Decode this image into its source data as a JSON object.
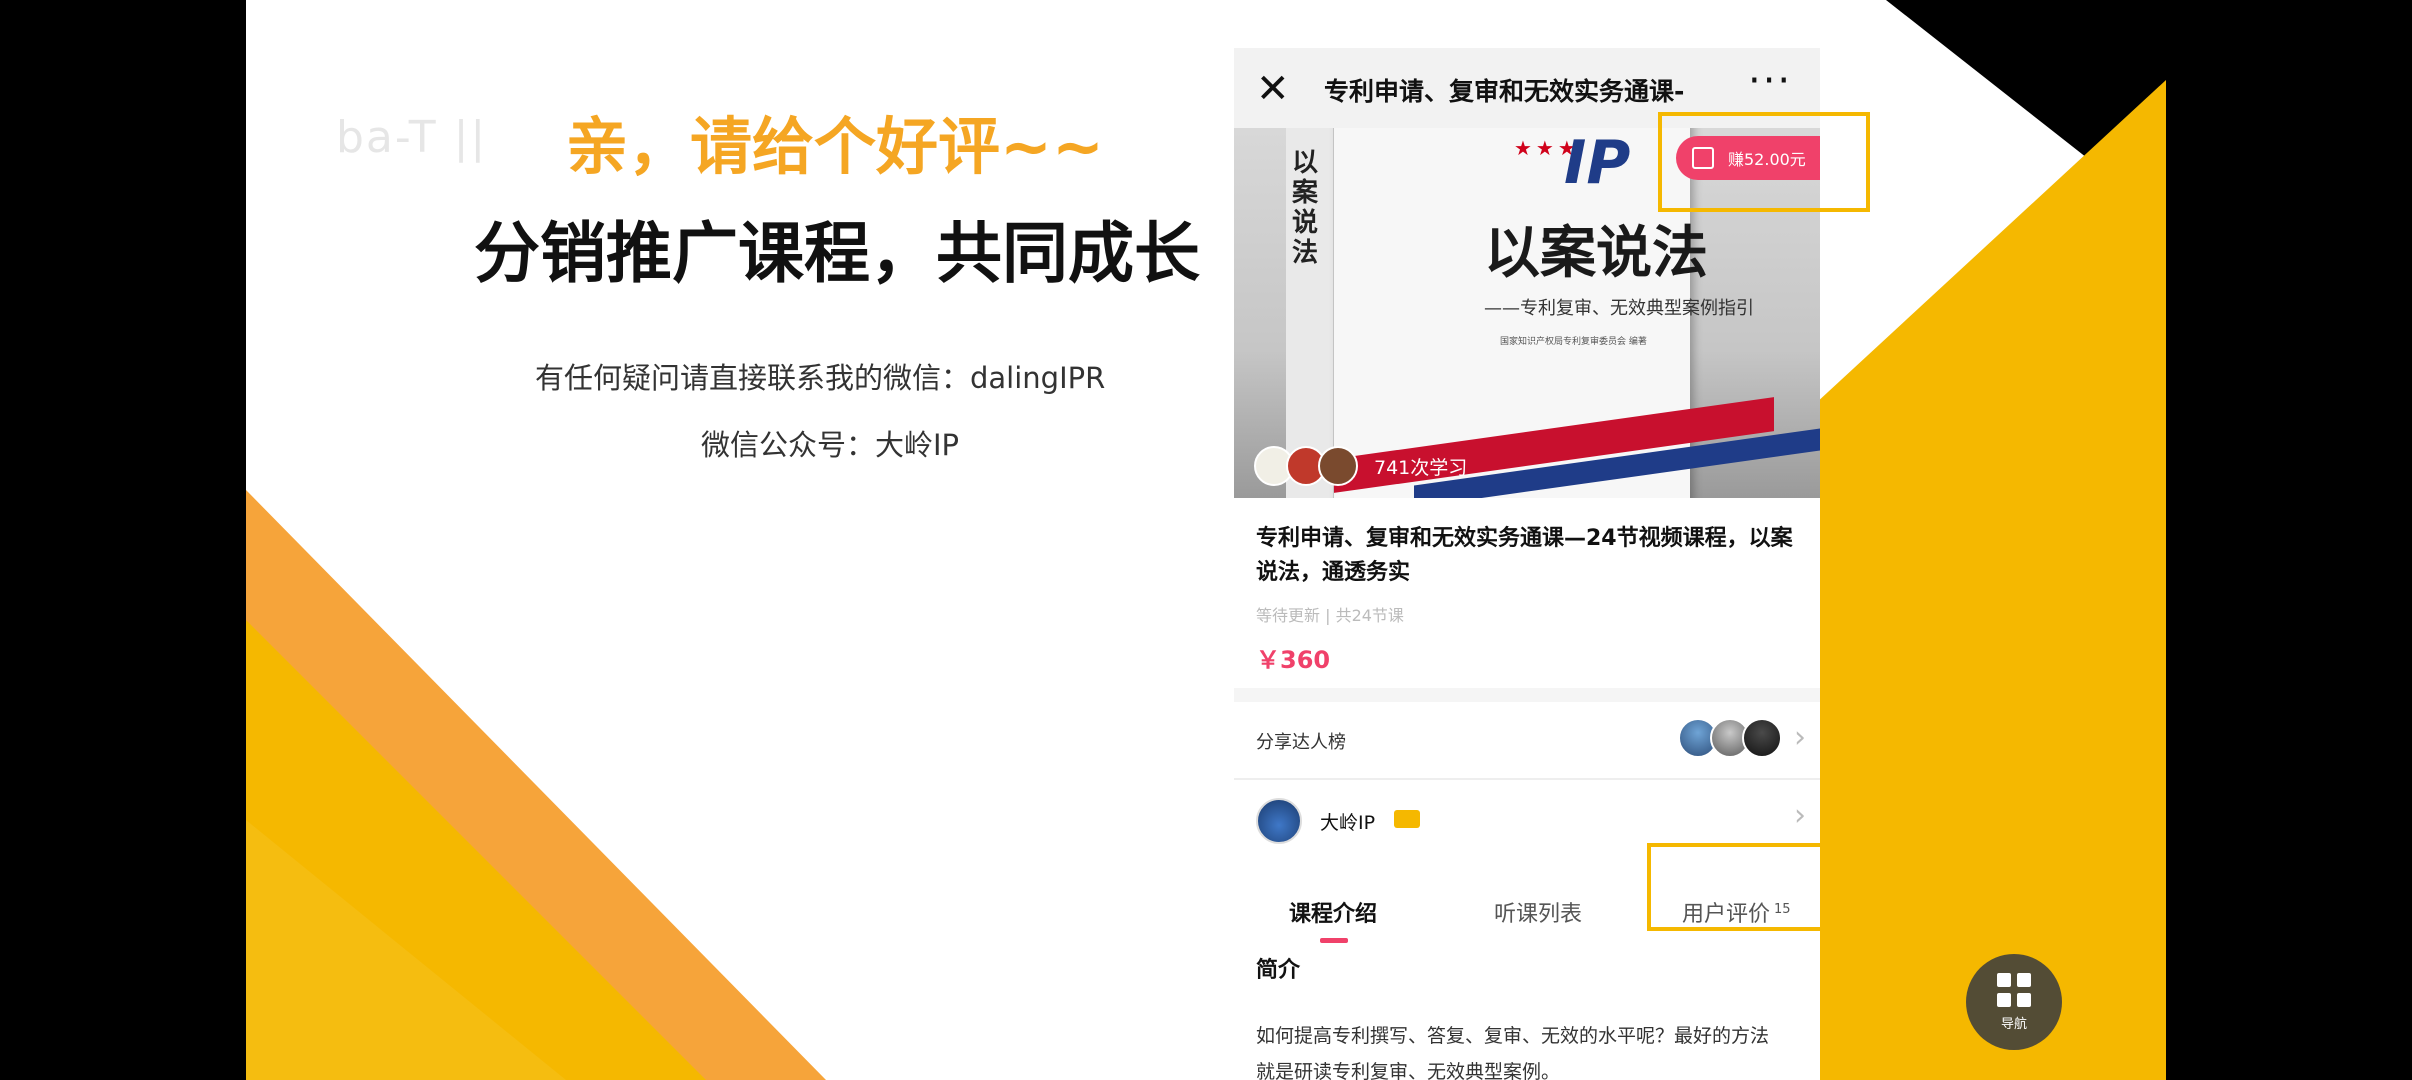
{
  "slide": {
    "ghost_logo": "ba-T ||",
    "headline": "亲，请给个好评~~",
    "subline": "分销推广课程，共同成长",
    "contact_wechat": "有任何疑问请直接联系我的微信：dalingIPR",
    "contact_public": "微信公众号：大岭IP"
  },
  "phone": {
    "nav": {
      "close_icon": "close-icon",
      "title": "专利申请、复审和无效实务通课-",
      "more_icon": "more-icon"
    },
    "cover": {
      "spine_text": "以案说法",
      "logo": "IP",
      "book_title": "以案说法",
      "book_subtitle": "——专利复审、无效典型案例指引",
      "book_publisher": "国家知识产权局专利复审委员会 编著",
      "study_count": "741次学习"
    },
    "earn_button": {
      "label": "赚52.00元",
      "icon": "share-icon"
    },
    "course": {
      "title": "专利申请、复审和无效实务通课—24节视频课程，以案说法，通透务实",
      "update_status": "等待更新 | 共24节课",
      "price": "￥360"
    },
    "ranking": {
      "label": "分享达人榜"
    },
    "author": {
      "name": "大岭IP"
    },
    "tabs": [
      {
        "label": "课程介绍",
        "active": true
      },
      {
        "label": "听课列表",
        "active": false
      },
      {
        "label": "用户评价",
        "count": "15",
        "active": false
      }
    ],
    "intro": {
      "heading": "简介",
      "body_line1": "如何提高专利撰写、答复、复审、无效的水平呢？最好的方法",
      "body_line2": "就是研读专利复审、无效典型案例。"
    },
    "fab": {
      "label": "导航",
      "icon": "grid-icon"
    }
  },
  "colors": {
    "accent_yellow": "#f5b800",
    "accent_orange": "#f5a623",
    "price_pink": "#f0416a"
  }
}
